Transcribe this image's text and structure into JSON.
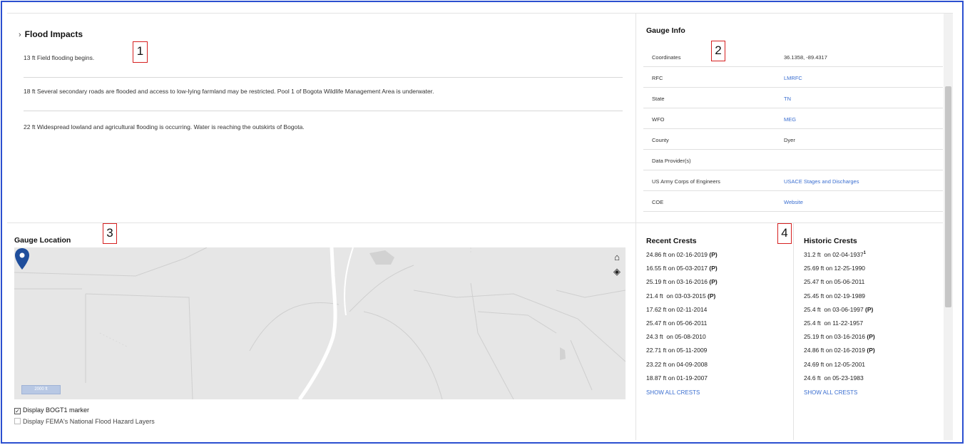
{
  "flood_impacts": {
    "title": "Flood Impacts",
    "items": [
      "13 ft Field flooding begins.",
      "18 ft Several secondary roads are flooded and access to low-lying farmland may be restricted. Pool 1 of Bogota Wildlife Management Area is underwater.",
      "22 ft Widespread lowland and agricultural flooding is occurring. Water is reaching the outskirts of Bogota."
    ]
  },
  "gauge_info": {
    "title": "Gauge Info",
    "rows": [
      {
        "key": "Coordinates",
        "value": "36.1358, -89.4317",
        "link": false
      },
      {
        "key": "RFC",
        "value": "LMRFC",
        "link": true
      },
      {
        "key": "State",
        "value": "TN",
        "link": true
      },
      {
        "key": "WFO",
        "value": "MEG",
        "link": true
      },
      {
        "key": "County",
        "value": "Dyer",
        "link": false
      },
      {
        "key": "Data Provider(s)",
        "value": "",
        "link": false
      },
      {
        "key": "US Army Corps of Engineers",
        "value": "USACE Stages and Discharges",
        "link": true
      },
      {
        "key": "COE",
        "value": "Website",
        "link": true
      }
    ]
  },
  "gauge_location": {
    "title": "Gauge Location",
    "home_icon": "home-icon",
    "layers_icon": "layers-icon",
    "scale_label": "2000 ft",
    "checkbox_marker": {
      "label": "Display BOGT1 marker",
      "checked": true
    },
    "checkbox_fema": {
      "label": "Display FEMA's National Flood Hazard Layers",
      "checked": false
    }
  },
  "recent_crests": {
    "title": "Recent Crests",
    "items": [
      {
        "height": "24.86 ft",
        "date": "on 02-16-2019",
        "flag": "(P)"
      },
      {
        "height": "16.55 ft",
        "date": "on 05-03-2017",
        "flag": "(P)"
      },
      {
        "height": "25.19 ft",
        "date": "on 03-16-2016",
        "flag": "(P)"
      },
      {
        "height": "21.4 ft ",
        "date": "on 03-03-2015",
        "flag": "(P)"
      },
      {
        "height": "17.62 ft",
        "date": "on 02-11-2014",
        "flag": ""
      },
      {
        "height": "25.47 ft",
        "date": "on 05-06-2011",
        "flag": ""
      },
      {
        "height": "24.3 ft ",
        "date": "on 05-08-2010",
        "flag": ""
      },
      {
        "height": "22.71 ft",
        "date": "on 05-11-2009",
        "flag": ""
      },
      {
        "height": "23.22 ft",
        "date": "on 04-09-2008",
        "flag": ""
      },
      {
        "height": "18.87 ft",
        "date": "on 01-19-2007",
        "flag": ""
      }
    ],
    "show_all": "SHOW ALL CRESTS"
  },
  "historic_crests": {
    "title": "Historic Crests",
    "items": [
      {
        "height": "31.2 ft ",
        "date": "on 02-04-1937",
        "flag": "",
        "sup": "1"
      },
      {
        "height": "25.69 ft",
        "date": "on 12-25-1990",
        "flag": "",
        "sup": ""
      },
      {
        "height": "25.47 ft",
        "date": "on 05-06-2011",
        "flag": "",
        "sup": ""
      },
      {
        "height": "25.45 ft",
        "date": "on 02-19-1989",
        "flag": "",
        "sup": ""
      },
      {
        "height": "25.4 ft ",
        "date": "on 03-06-1997",
        "flag": "(P)",
        "sup": ""
      },
      {
        "height": "25.4 ft ",
        "date": "on 11-22-1957",
        "flag": "",
        "sup": ""
      },
      {
        "height": "25.19 ft",
        "date": "on 03-16-2016",
        "flag": "(P)",
        "sup": ""
      },
      {
        "height": "24.86 ft",
        "date": "on 02-16-2019",
        "flag": "(P)",
        "sup": ""
      },
      {
        "height": "24.69 ft",
        "date": "on 12-05-2001",
        "flag": "",
        "sup": ""
      },
      {
        "height": "24.6 ft ",
        "date": "on 05-23-1983",
        "flag": "",
        "sup": ""
      }
    ],
    "show_all": "SHOW ALL CRESTS"
  },
  "annotations": [
    "1",
    "2",
    "3",
    "4"
  ],
  "colors": {
    "link": "#3a6ed0",
    "marker": "#1f4e9c",
    "annotation": "#d62020",
    "frame": "#2b4fd0"
  }
}
